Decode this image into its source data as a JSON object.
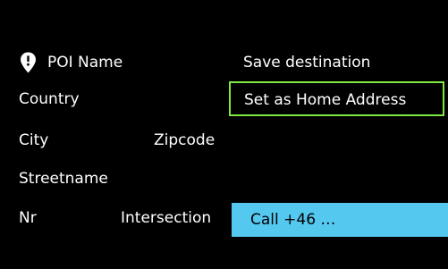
{
  "colors": {
    "background": "#000000",
    "text": "#ffffff",
    "focus_border": "#7ee83f",
    "call_highlight": "#55c8f0"
  },
  "poi": {
    "icon": "location-pin-icon",
    "name_label": "POI Name"
  },
  "address": {
    "country_label": "Country",
    "city_label": "City",
    "zipcode_label": "Zipcode",
    "streetname_label": "Streetname",
    "nr_label": "Nr",
    "intersection_label": "Intersection"
  },
  "actions": {
    "save_destination": "Save destination",
    "set_home": "Set as Home Address",
    "call": "Call +46 …"
  }
}
